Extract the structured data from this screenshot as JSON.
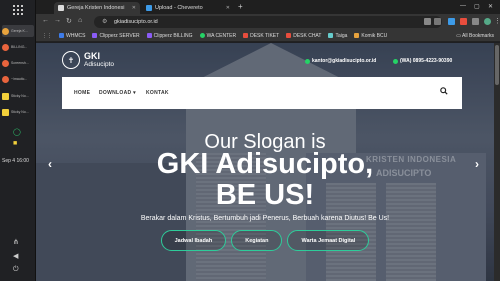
{
  "taskbar": {
    "apps": [
      {
        "label": "Gereja K...",
        "color": "#e8a33d"
      },
      {
        "label": "BILLING...",
        "color": "#e8643d"
      },
      {
        "label": "Screensh...",
        "color": "#e8643d"
      },
      {
        "label": "~/mautic...",
        "color": "#e8643d"
      },
      {
        "label": "Sticky No...",
        "color": "#f2d03b"
      },
      {
        "label": "Sticky No...",
        "color": "#f2d03b"
      }
    ],
    "clock": "Sep 4  16:00"
  },
  "tabs": [
    {
      "label": "Gereja Kristen Indonesi",
      "active": true
    },
    {
      "label": "Upload - Chevereto",
      "active": false
    }
  ],
  "address": "gkiadisucipto.or.id",
  "bookmarks": [
    {
      "label": "WHMCS",
      "color": "#3d7be8"
    },
    {
      "label": "Clipperz SERVER",
      "color": "#8b5cf6"
    },
    {
      "label": "Clipperz BILLING",
      "color": "#8b5cf6"
    },
    {
      "label": "WA CENTER",
      "color": "#25d366"
    },
    {
      "label": "DESK TIKET",
      "color": "#e84d3d"
    },
    {
      "label": "DESK CHAT",
      "color": "#e84d3d"
    },
    {
      "label": "Taiga",
      "color": "#6cc"
    },
    {
      "label": "Komik BCU",
      "color": "#e8a33d"
    }
  ],
  "all_bookmarks": "All Bookmarks",
  "site": {
    "logo_line1": "GKI",
    "logo_line2": "Adisucipto",
    "email": "kantor@gkiadisucipto.or.id",
    "phone": "(WA) 0895-4223-90390",
    "nav": {
      "home": "HOME",
      "download": "DOWNLOAD ▾",
      "kontak": "KONTAK"
    },
    "wall_text1": "KRISTEN INDONESIA",
    "wall_text2": "ADISUCIPTO",
    "hero_line1": "Our Slogan is",
    "hero_line2": "GKI Adisucipto,",
    "hero_line3": "BE US!",
    "subtitle": "Berakar dalam Kristus, Bertumbuh jadi Penerus, Berbuah karena Diutus! Be Us!",
    "buttons": [
      "Jadwal Ibadah",
      "Kegiatan",
      "Warta Jemaat Digital"
    ]
  }
}
